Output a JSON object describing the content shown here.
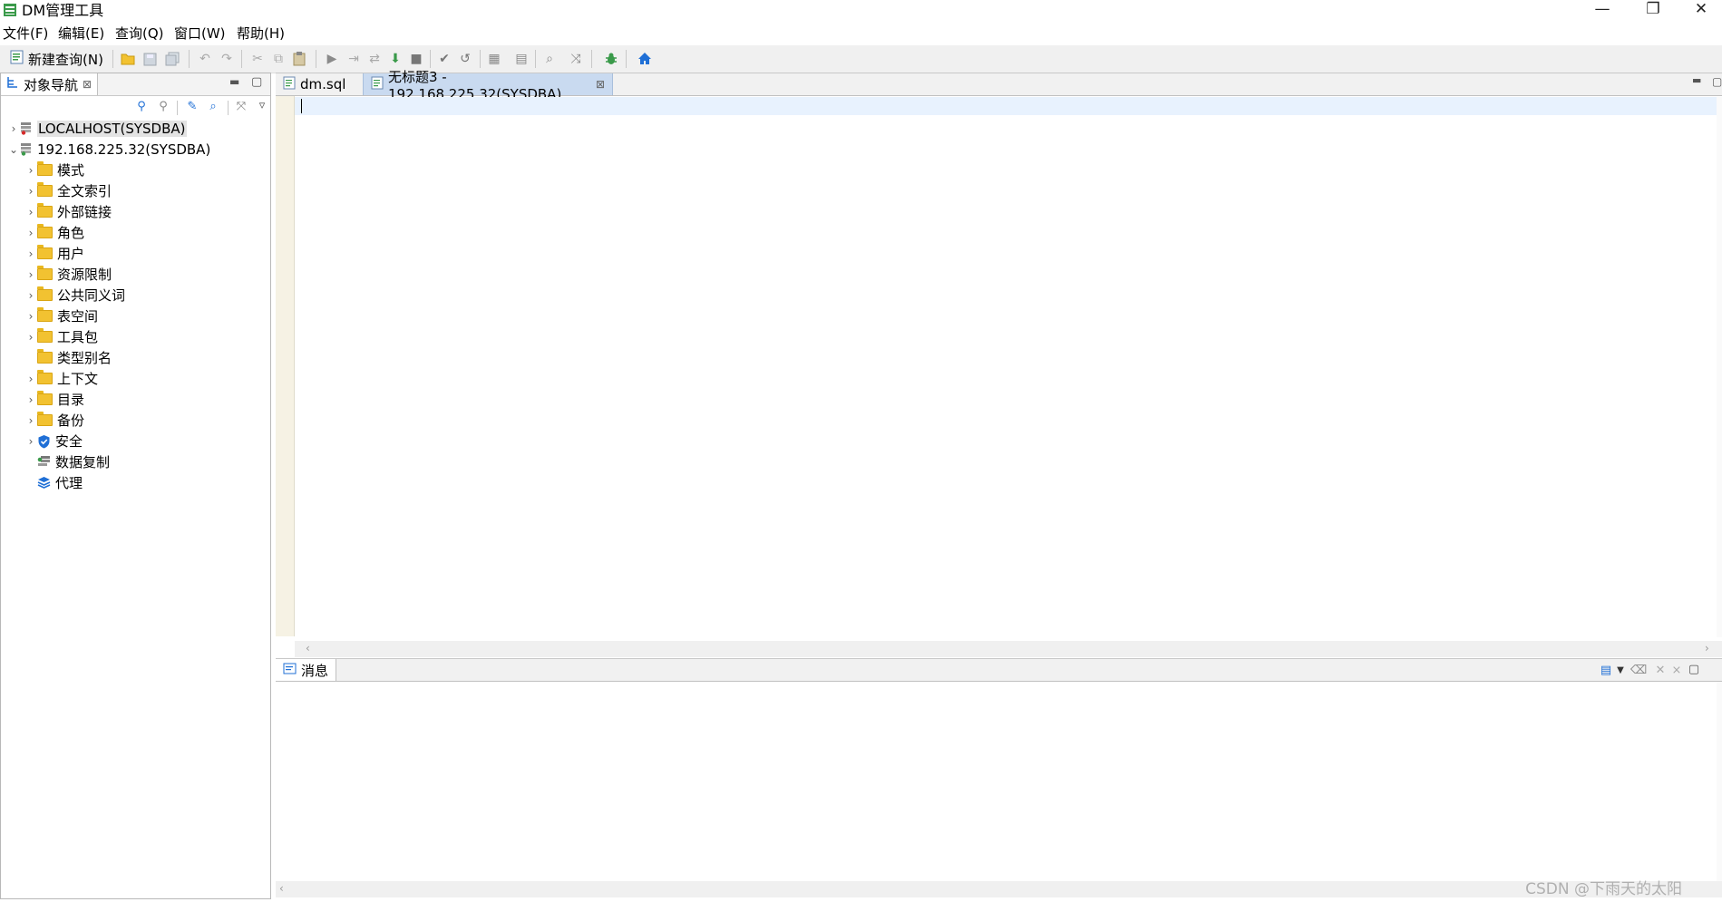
{
  "window": {
    "title": "DM管理工具",
    "minimize_label": "—",
    "restore_label": "❐",
    "close_label": "✕"
  },
  "menu": [
    {
      "label": "文件(F)"
    },
    {
      "label": "编辑(E)"
    },
    {
      "label": "查询(Q)"
    },
    {
      "label": "窗口(W)"
    },
    {
      "label": "帮助(H)"
    }
  ],
  "toolbar": {
    "new_query_label": "新建查询(N)"
  },
  "navigator": {
    "tab_label": "对象导航",
    "tree": [
      {
        "label": "LOCALHOST(SYSDBA)",
        "type": "server-disconnected",
        "expanded": false,
        "selected": true
      },
      {
        "label": "192.168.225.32(SYSDBA)",
        "type": "server-connected",
        "expanded": true,
        "children": [
          {
            "label": "模式",
            "icon": "folder",
            "expandable": true
          },
          {
            "label": "全文索引",
            "icon": "folder",
            "expandable": true
          },
          {
            "label": "外部链接",
            "icon": "folder",
            "expandable": true
          },
          {
            "label": "角色",
            "icon": "folder",
            "expandable": true
          },
          {
            "label": "用户",
            "icon": "folder",
            "expandable": true
          },
          {
            "label": "资源限制",
            "icon": "folder",
            "expandable": true
          },
          {
            "label": "公共同义词",
            "icon": "folder",
            "expandable": true
          },
          {
            "label": "表空间",
            "icon": "folder",
            "expandable": true
          },
          {
            "label": "工具包",
            "icon": "folder",
            "expandable": true
          },
          {
            "label": "类型别名",
            "icon": "folder",
            "expandable": false
          },
          {
            "label": "上下文",
            "icon": "folder",
            "expandable": true
          },
          {
            "label": "目录",
            "icon": "folder",
            "expandable": true
          },
          {
            "label": "备份",
            "icon": "folder",
            "expandable": true
          },
          {
            "label": "安全",
            "icon": "shield-icon",
            "expandable": true
          },
          {
            "label": "数据复制",
            "icon": "replication-icon",
            "expandable": false
          },
          {
            "label": "代理",
            "icon": "layers-icon",
            "expandable": false
          }
        ]
      }
    ]
  },
  "editor": {
    "tabs": [
      {
        "label": "dm.sql",
        "active": false
      },
      {
        "label": "无标题3 - 192.168.225.32(SYSDBA)",
        "active": true
      }
    ],
    "content": ""
  },
  "messages": {
    "tab_label": "消息"
  },
  "watermark": "CSDN @下雨天的太阳",
  "colors": {
    "folder": "#f2c231",
    "accent_blue": "#1f6fd6",
    "current_line": "#e8f2fe",
    "ruler": "#f6f2e4"
  }
}
